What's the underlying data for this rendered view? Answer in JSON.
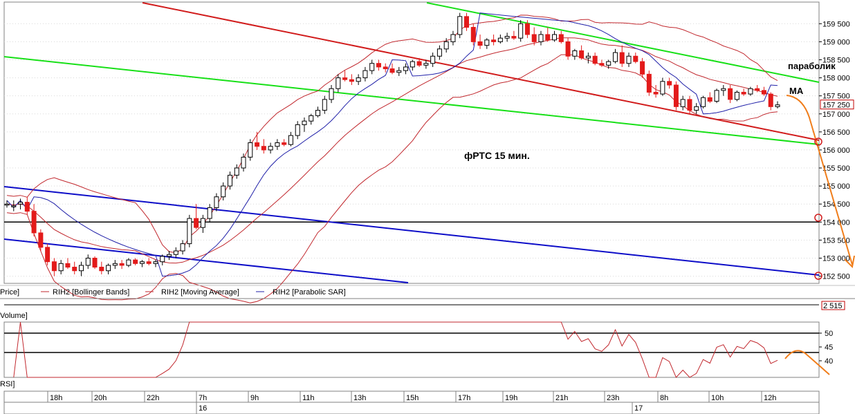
{
  "chart_data": {
    "type": "candlestick",
    "annotation_title": "фРТС   15 мин.",
    "labels": {
      "parabolic": "параболик",
      "ma": "MA"
    },
    "price_ticks": [
      "159 500",
      "159 000",
      "158 500",
      "158 000",
      "157 500",
      "157 000",
      "156 500",
      "156 000",
      "155 500",
      "155 000",
      "154 500",
      "154 000",
      "153 500",
      "153 000",
      "152 500"
    ],
    "ylim": [
      152300,
      160100
    ],
    "last_price": "157 250",
    "legend": [
      "Price]",
      "RIH2 [Bollinger Bands]",
      "RIH2 [Moving Average]",
      "RIH2 [Parabolic SAR]"
    ],
    "volume": {
      "label": "Volume]",
      "value": "2 515"
    },
    "rsi": {
      "label": "RSI]",
      "ticks": [
        "50",
        "45",
        "40"
      ],
      "ylim": [
        34,
        54
      ],
      "levels": [
        50,
        43
      ]
    },
    "time_ticks": [
      "18h",
      "20h",
      "22h",
      "7h",
      "9h",
      "11h",
      "13h",
      "15h",
      "17h",
      "19h",
      "21h",
      "23h",
      "8h",
      "10h",
      "12h"
    ],
    "date_ticks": [
      "16",
      "17"
    ],
    "colors": {
      "up": "#ffffff",
      "down": "#e31a1a",
      "bollinger": "#c1272d",
      "sar": "#1f1fa8",
      "trend_green": "#17e017",
      "trend_red": "#d11b1b",
      "trend_blue": "#0d0dc8",
      "forecast": "#f07d1a"
    },
    "candles_ohlc": [
      [
        154500,
        154600,
        154400,
        154500
      ],
      [
        154450,
        154600,
        154300,
        154450
      ],
      [
        154500,
        154650,
        154350,
        154550
      ],
      [
        154550,
        154700,
        154200,
        154300
      ],
      [
        154300,
        154500,
        153600,
        153700
      ],
      [
        153700,
        153800,
        153200,
        153300
      ],
      [
        153300,
        153400,
        152800,
        152900
      ],
      [
        152900,
        153000,
        152500,
        152650
      ],
      [
        152650,
        152950,
        152550,
        152850
      ],
      [
        152850,
        153000,
        152700,
        152750
      ],
      [
        152750,
        152900,
        152550,
        152650
      ],
      [
        152650,
        152900,
        152500,
        152800
      ],
      [
        152800,
        153100,
        152700,
        153000
      ],
      [
        153000,
        153050,
        152700,
        152750
      ],
      [
        152750,
        152900,
        152550,
        152650
      ],
      [
        152650,
        152850,
        152550,
        152800
      ],
      [
        152800,
        152950,
        152700,
        152850
      ],
      [
        152850,
        152950,
        152700,
        152800
      ],
      [
        152800,
        153000,
        152750,
        152950
      ],
      [
        152950,
        153000,
        152800,
        152850
      ],
      [
        152850,
        152950,
        152750,
        152900
      ],
      [
        152900,
        153000,
        152800,
        152850
      ],
      [
        152850,
        152950,
        152750,
        152900
      ],
      [
        152900,
        153100,
        152800,
        153050
      ],
      [
        153050,
        153200,
        152950,
        153100
      ],
      [
        153100,
        153300,
        153000,
        153200
      ],
      [
        153200,
        153500,
        153100,
        153400
      ],
      [
        153400,
        154200,
        153300,
        154100
      ],
      [
        154100,
        154500,
        153800,
        153850
      ],
      [
        153850,
        154200,
        153700,
        154100
      ],
      [
        154100,
        154500,
        154000,
        154400
      ],
      [
        154400,
        154800,
        154300,
        154700
      ],
      [
        154700,
        155100,
        154600,
        155000
      ],
      [
        155000,
        155400,
        154900,
        155300
      ],
      [
        155300,
        155600,
        155200,
        155500
      ],
      [
        155500,
        155900,
        155400,
        155800
      ],
      [
        155800,
        156300,
        155700,
        156200
      ],
      [
        156200,
        156500,
        156000,
        156100
      ],
      [
        156100,
        156300,
        155900,
        156000
      ],
      [
        156000,
        156200,
        155900,
        156100
      ],
      [
        156100,
        156300,
        156000,
        156200
      ],
      [
        156200,
        156300,
        156100,
        156150
      ],
      [
        156150,
        156500,
        156100,
        156400
      ],
      [
        156400,
        156800,
        156300,
        156700
      ],
      [
        156700,
        156900,
        156500,
        156800
      ],
      [
        156800,
        157000,
        156700,
        156950
      ],
      [
        156950,
        157200,
        156900,
        157100
      ],
      [
        157100,
        157500,
        157000,
        157400
      ],
      [
        157400,
        157800,
        157300,
        157700
      ],
      [
        157700,
        158100,
        157600,
        158000
      ],
      [
        158000,
        158200,
        157900,
        157950
      ],
      [
        157950,
        158100,
        157800,
        157900
      ],
      [
        157900,
        158100,
        157800,
        158000
      ],
      [
        158000,
        158300,
        157900,
        158200
      ],
      [
        158200,
        158500,
        158100,
        158400
      ],
      [
        158400,
        158500,
        158200,
        158300
      ],
      [
        158300,
        158400,
        158150,
        158250
      ],
      [
        158250,
        158400,
        158100,
        158150
      ],
      [
        158150,
        158300,
        158050,
        158200
      ],
      [
        158200,
        158400,
        158100,
        158300
      ],
      [
        158300,
        158500,
        158200,
        158450
      ],
      [
        158450,
        158550,
        158300,
        158350
      ],
      [
        158350,
        158500,
        158250,
        158400
      ],
      [
        158400,
        158700,
        158300,
        158600
      ],
      [
        158600,
        158900,
        158500,
        158800
      ],
      [
        158800,
        159100,
        158700,
        159000
      ],
      [
        159000,
        159300,
        158900,
        159200
      ],
      [
        159200,
        159800,
        159100,
        159700
      ],
      [
        159700,
        159800,
        159300,
        159400
      ],
      [
        159400,
        159500,
        158900,
        159000
      ],
      [
        159000,
        159200,
        158800,
        158900
      ],
      [
        158900,
        159100,
        158800,
        159050
      ],
      [
        159050,
        159200,
        158900,
        159000
      ],
      [
        159000,
        159200,
        158950,
        159100
      ],
      [
        159100,
        159250,
        159000,
        159150
      ],
      [
        159150,
        159300,
        159050,
        159100
      ],
      [
        159100,
        159600,
        159000,
        159500
      ],
      [
        159500,
        159600,
        159100,
        159200
      ],
      [
        159200,
        159400,
        158900,
        159000
      ],
      [
        159000,
        159300,
        158900,
        159200
      ],
      [
        159200,
        159400,
        159000,
        159050
      ],
      [
        159050,
        159300,
        159000,
        159200
      ],
      [
        159200,
        159300,
        158950,
        159000
      ],
      [
        159000,
        159100,
        158500,
        158600
      ],
      [
        158600,
        158800,
        158500,
        158750
      ],
      [
        158750,
        158900,
        158500,
        158550
      ],
      [
        158550,
        158700,
        158400,
        158600
      ],
      [
        158600,
        158700,
        158350,
        158400
      ],
      [
        158400,
        158500,
        158300,
        158350
      ],
      [
        158350,
        158500,
        158250,
        158450
      ],
      [
        158450,
        158800,
        158400,
        158700
      ],
      [
        158700,
        158900,
        158300,
        158400
      ],
      [
        158400,
        158700,
        158300,
        158600
      ],
      [
        158600,
        158700,
        158400,
        158450
      ],
      [
        158450,
        158550,
        158000,
        158100
      ],
      [
        158100,
        158200,
        157500,
        157600
      ],
      [
        157600,
        157800,
        157450,
        157550
      ],
      [
        157550,
        158000,
        157500,
        157900
      ],
      [
        157900,
        158000,
        157700,
        157800
      ],
      [
        157800,
        157900,
        157100,
        157200
      ],
      [
        157200,
        157500,
        157100,
        157400
      ],
      [
        157400,
        157500,
        157000,
        157100
      ],
      [
        157100,
        157300,
        157000,
        157200
      ],
      [
        157200,
        157500,
        157150,
        157450
      ],
      [
        157450,
        157600,
        157300,
        157350
      ],
      [
        157350,
        157700,
        157300,
        157650
      ],
      [
        157650,
        157800,
        157500,
        157700
      ],
      [
        157700,
        157800,
        157300,
        157400
      ],
      [
        157400,
        157650,
        157350,
        157600
      ],
      [
        157600,
        157700,
        157500,
        157550
      ],
      [
        157550,
        157750,
        157500,
        157700
      ],
      [
        157700,
        157800,
        157600,
        157650
      ],
      [
        157650,
        157750,
        157500,
        157550
      ],
      [
        157550,
        157600,
        157100,
        157200
      ],
      [
        157200,
        157350,
        157150,
        157250
      ]
    ]
  }
}
